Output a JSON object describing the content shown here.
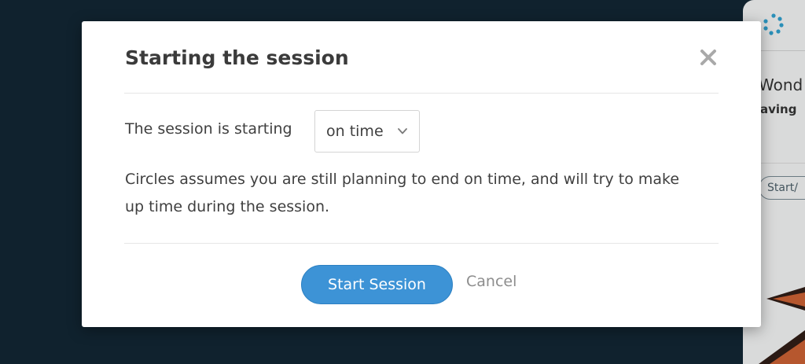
{
  "background": {
    "title_fragment": "Wond",
    "subtitle_fragment": "aving",
    "pill_fragment": "Start/"
  },
  "modal": {
    "title": "Starting the session",
    "close_icon": "close-icon",
    "start_row_label": "The session is starting",
    "timing_select": {
      "value": "on time",
      "icon": "chevron-down-icon"
    },
    "info_text": "Circles assumes you are still planning to end on time, and will try to make up time during the session.",
    "primary_button": "Start Session",
    "secondary_button": "Cancel"
  },
  "colors": {
    "overlay": "#10222e",
    "primary": "#3d93d6",
    "text": "#3f3f3f",
    "muted": "#8d8d8d"
  }
}
